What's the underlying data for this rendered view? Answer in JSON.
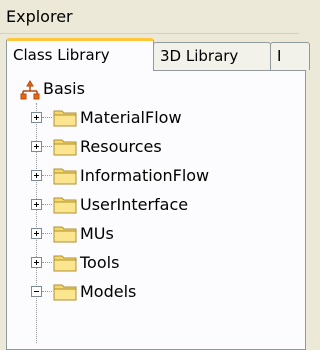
{
  "window": {
    "title": "Explorer"
  },
  "tabs": [
    {
      "label": "Class Library"
    },
    {
      "label": "3D Library"
    },
    {
      "label": "I"
    }
  ],
  "tree": {
    "root": {
      "label": "Basis",
      "icon": "hierarchy-icon"
    },
    "items": [
      {
        "label": "MaterialFlow",
        "expanded": false
      },
      {
        "label": "Resources",
        "expanded": false
      },
      {
        "label": "InformationFlow",
        "expanded": false
      },
      {
        "label": "UserInterface",
        "expanded": false
      },
      {
        "label": "MUs",
        "expanded": false
      },
      {
        "label": "Tools",
        "expanded": false
      },
      {
        "label": "Models",
        "expanded": true
      }
    ]
  },
  "colors": {
    "background": "#ece9d8",
    "active_tab_accent": "#ffc83c",
    "folder": "#f5d86b",
    "root_icon": "#e86a0c"
  }
}
